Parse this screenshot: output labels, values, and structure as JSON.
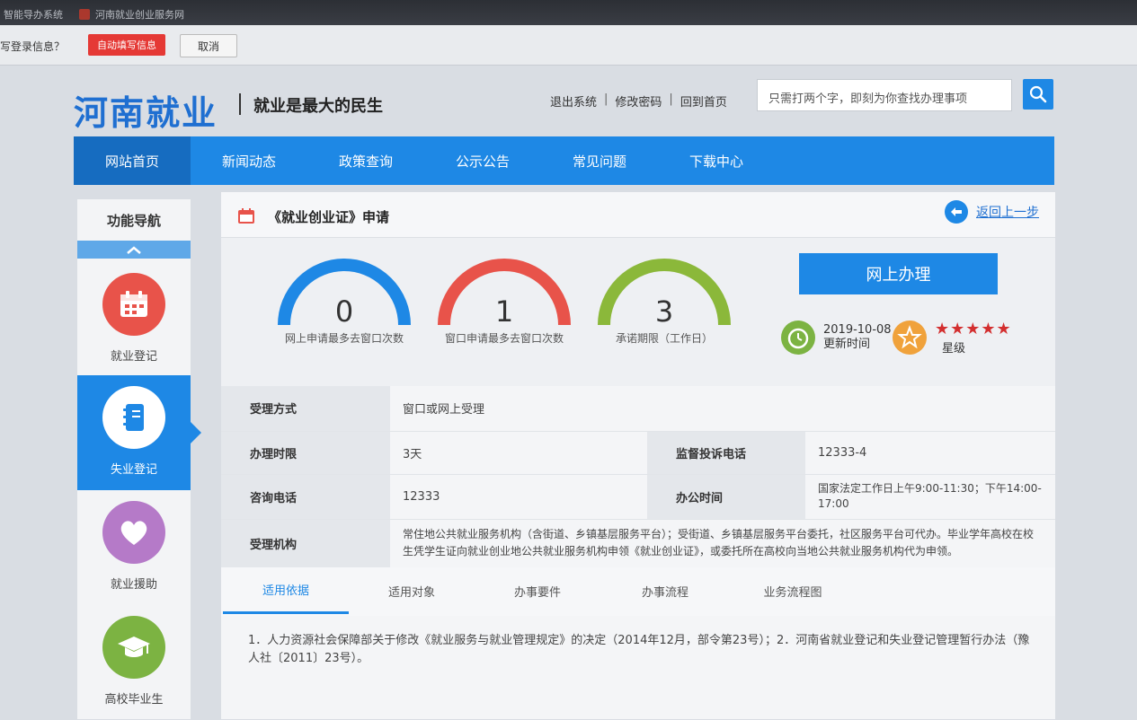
{
  "browser": {
    "tabs": [
      "智能导办系统",
      "河南就业创业服务网"
    ]
  },
  "password_prompt": {
    "text": "写登录信息？",
    "autofill_label": "自动填写信息",
    "cancel_label": "取消"
  },
  "header": {
    "logo": "河南就业",
    "slogan": "就业是最大的民生",
    "links": [
      "退出系统",
      "修改密码",
      "回到首页"
    ],
    "search_placeholder": "只需打两个字，即刻为你查找办理事项"
  },
  "nav": {
    "items": [
      "网站首页",
      "新闻动态",
      "政策查询",
      "公示公告",
      "常见问题",
      "下载中心"
    ],
    "active": "网站首页"
  },
  "sidebar": {
    "title": "功能导航",
    "items": [
      {
        "label": "就业登记",
        "icon": "calendar-icon",
        "color": "#e8534a"
      },
      {
        "label": "失业登记",
        "icon": "notebook-icon",
        "color": "#1e88e5"
      },
      {
        "label": "就业援助",
        "icon": "heart-icon",
        "color": "#b57ac8"
      },
      {
        "label": "高校毕业生",
        "icon": "graduation-cap-icon",
        "color": "#7cb342"
      }
    ],
    "active_index": 1
  },
  "panel": {
    "title": "《就业创业证》申请",
    "back_label": "返回上一步",
    "gauges": [
      {
        "value": "0",
        "caption": "网上申请最多去窗口次数",
        "color": "#1e88e5"
      },
      {
        "value": "1",
        "caption": "窗口申请最多去窗口次数",
        "color": "#e8534a"
      },
      {
        "value": "3",
        "caption": "承诺期限（工作日）",
        "color": "#8bb83a"
      }
    ],
    "apply_button": "网上办理",
    "update_date": "2019-10-08",
    "update_label": "更新时间",
    "rating_label": "星级",
    "rating": 5
  },
  "info": {
    "accept_method_label": "受理方式",
    "accept_method": "窗口或网上受理",
    "time_limit_label": "办理时限",
    "time_limit": "3天",
    "complaint_label": "监督投诉电话",
    "complaint": "12333-4",
    "consult_label": "咨询电话",
    "consult": "12333",
    "office_hours_label": "办公时间",
    "office_hours": "国家法定工作日上午9:00-11:30；下午14:00-17:00",
    "agency_label": "受理机构",
    "agency": "常住地公共就业服务机构（含街道、乡镇基层服务平台）；受街道、乡镇基层服务平台委托，社区服务平台可代办。毕业学年高校在校生凭学生证向就业创业地公共就业服务机构申领《就业创业证》，或委托所在高校向当地公共就业服务机构代为申领。"
  },
  "tabs": {
    "items": [
      "适用依据",
      "适用对象",
      "办事要件",
      "办事流程",
      "业务流程图"
    ],
    "active": "适用依据"
  },
  "content": {
    "text": "1．人力资源社会保障部关于修改《就业服务与就业管理规定》的决定（2014年12月，部令第23号）；2．河南省就业登记和失业登记管理暂行办法（豫人社〔2011〕23号）。"
  }
}
